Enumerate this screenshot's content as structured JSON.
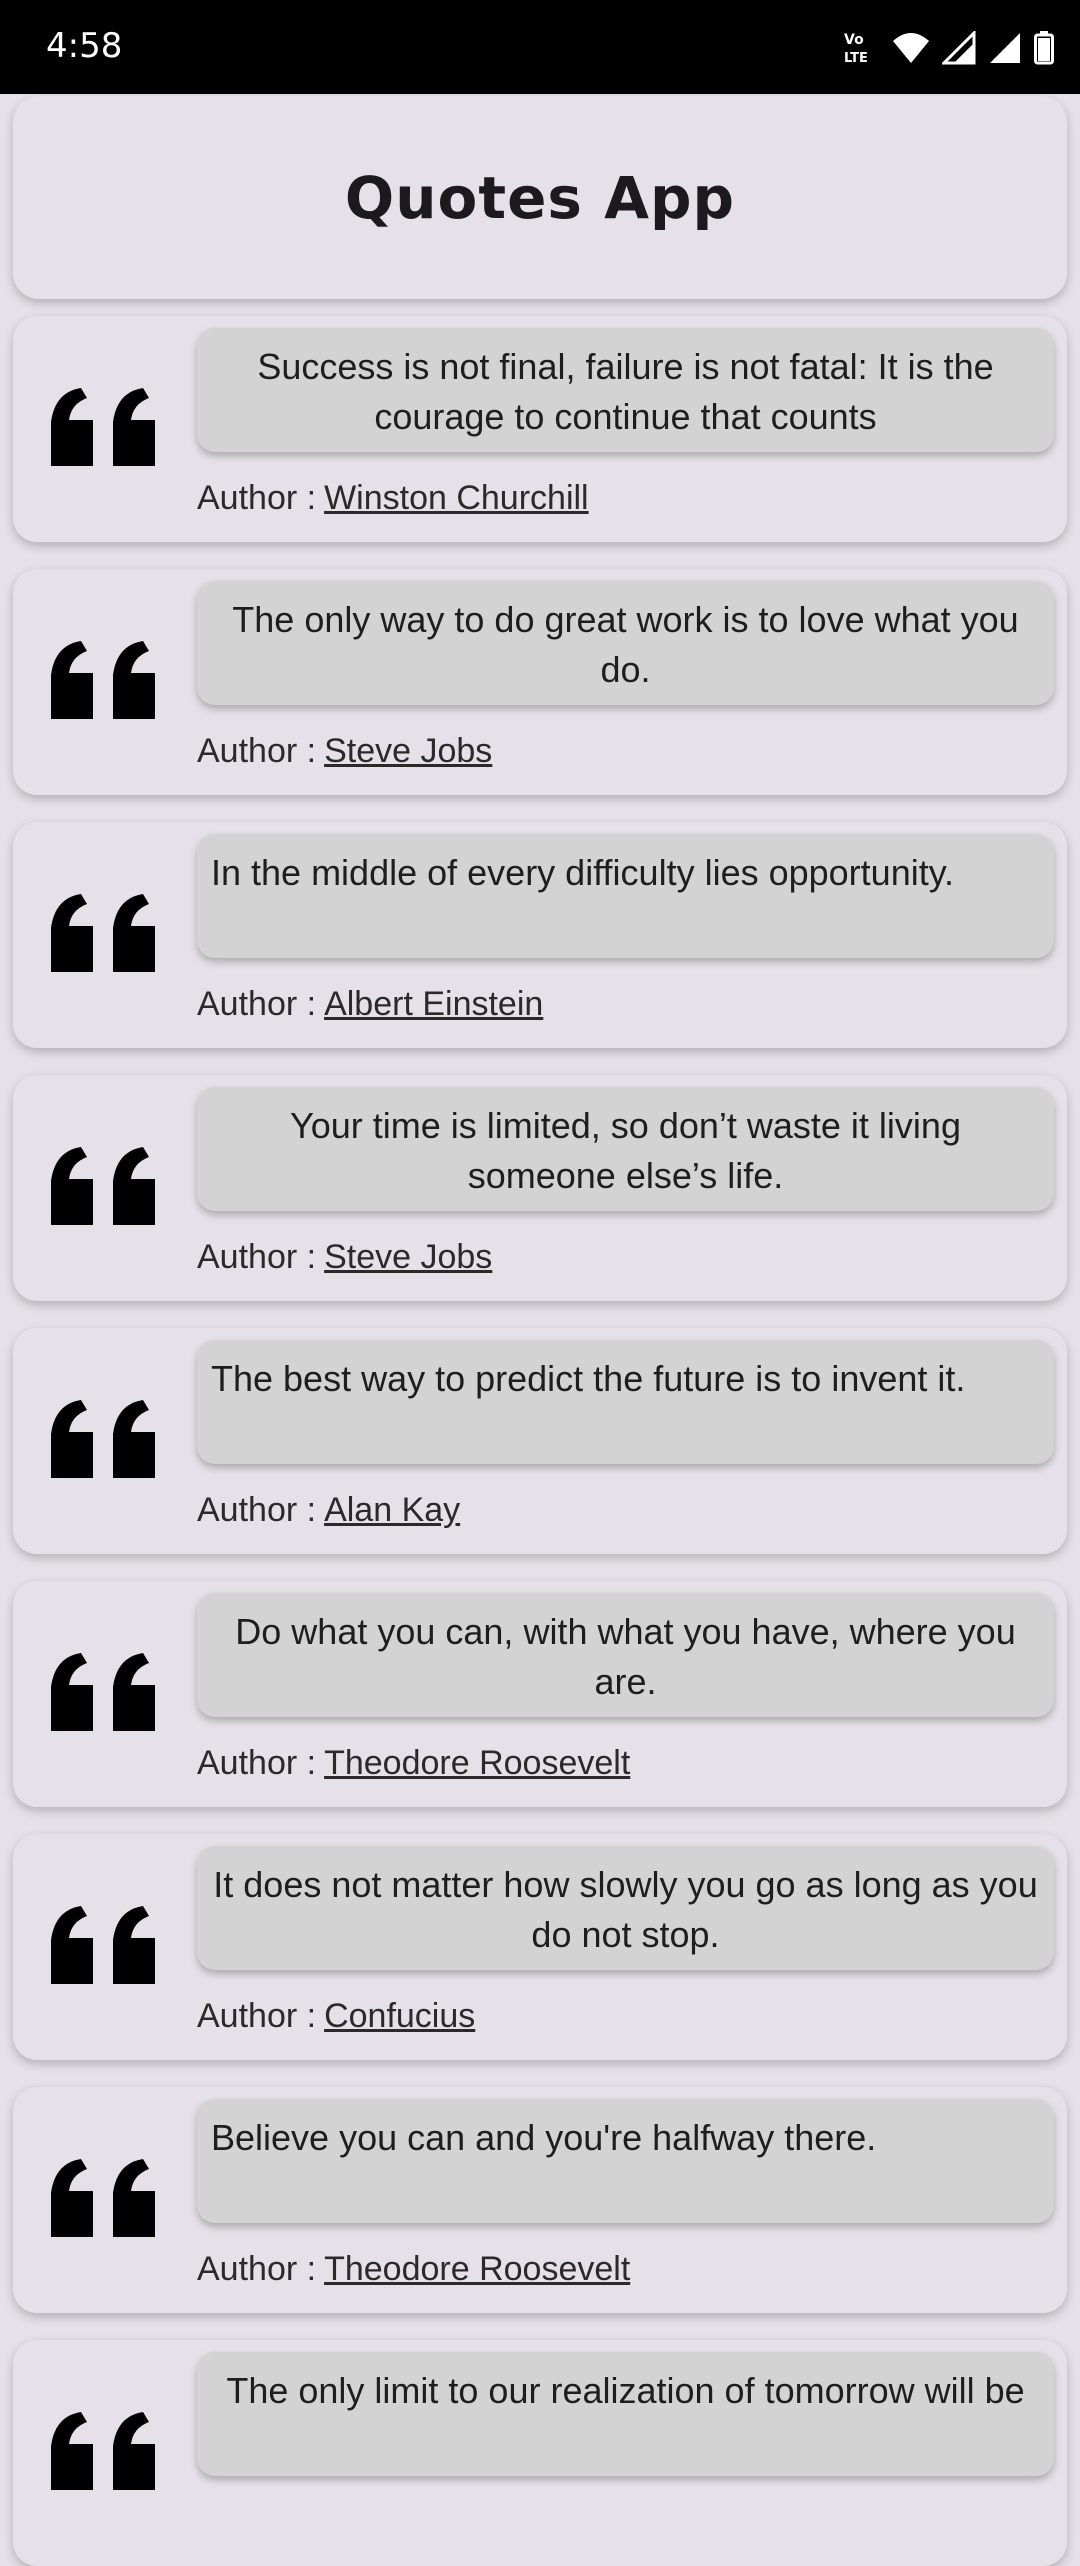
{
  "status_bar": {
    "time": "4:58",
    "icons": [
      "volte-icon",
      "wifi-icon",
      "signal-icon",
      "battery-icon"
    ],
    "volte_top": "Vo",
    "volte_bottom": "LTE"
  },
  "header": {
    "title": "Quotes App"
  },
  "author_prefix": "Author :",
  "quotes": [
    {
      "text": "Success is not final, failure is not fatal: It is the courage to continue that counts",
      "author": "Winston Churchill",
      "align": "center"
    },
    {
      "text": "The only way to do great work is to love what you do.",
      "author": "Steve Jobs",
      "align": "center"
    },
    {
      "text": "In the middle of every difficulty lies opportunity.",
      "author": "Albert Einstein",
      "align": "left"
    },
    {
      "text": "Your time is limited, so don’t waste it living someone else’s life.",
      "author": "Steve Jobs",
      "align": "center"
    },
    {
      "text": "The best way to predict the future is to invent it.",
      "author": "Alan Kay",
      "align": "left"
    },
    {
      "text": "Do what you can, with what you have, where you are.",
      "author": "Theodore Roosevelt",
      "align": "center"
    },
    {
      "text": "It does not matter how slowly you go as long as you do not stop.",
      "author": "Confucius",
      "align": "center"
    },
    {
      "text": "Believe you can and you're halfway there.",
      "author": "Theodore Roosevelt",
      "align": "left"
    },
    {
      "text": "The only limit to our realization of tomorrow will be",
      "author": "",
      "align": "center"
    }
  ]
}
